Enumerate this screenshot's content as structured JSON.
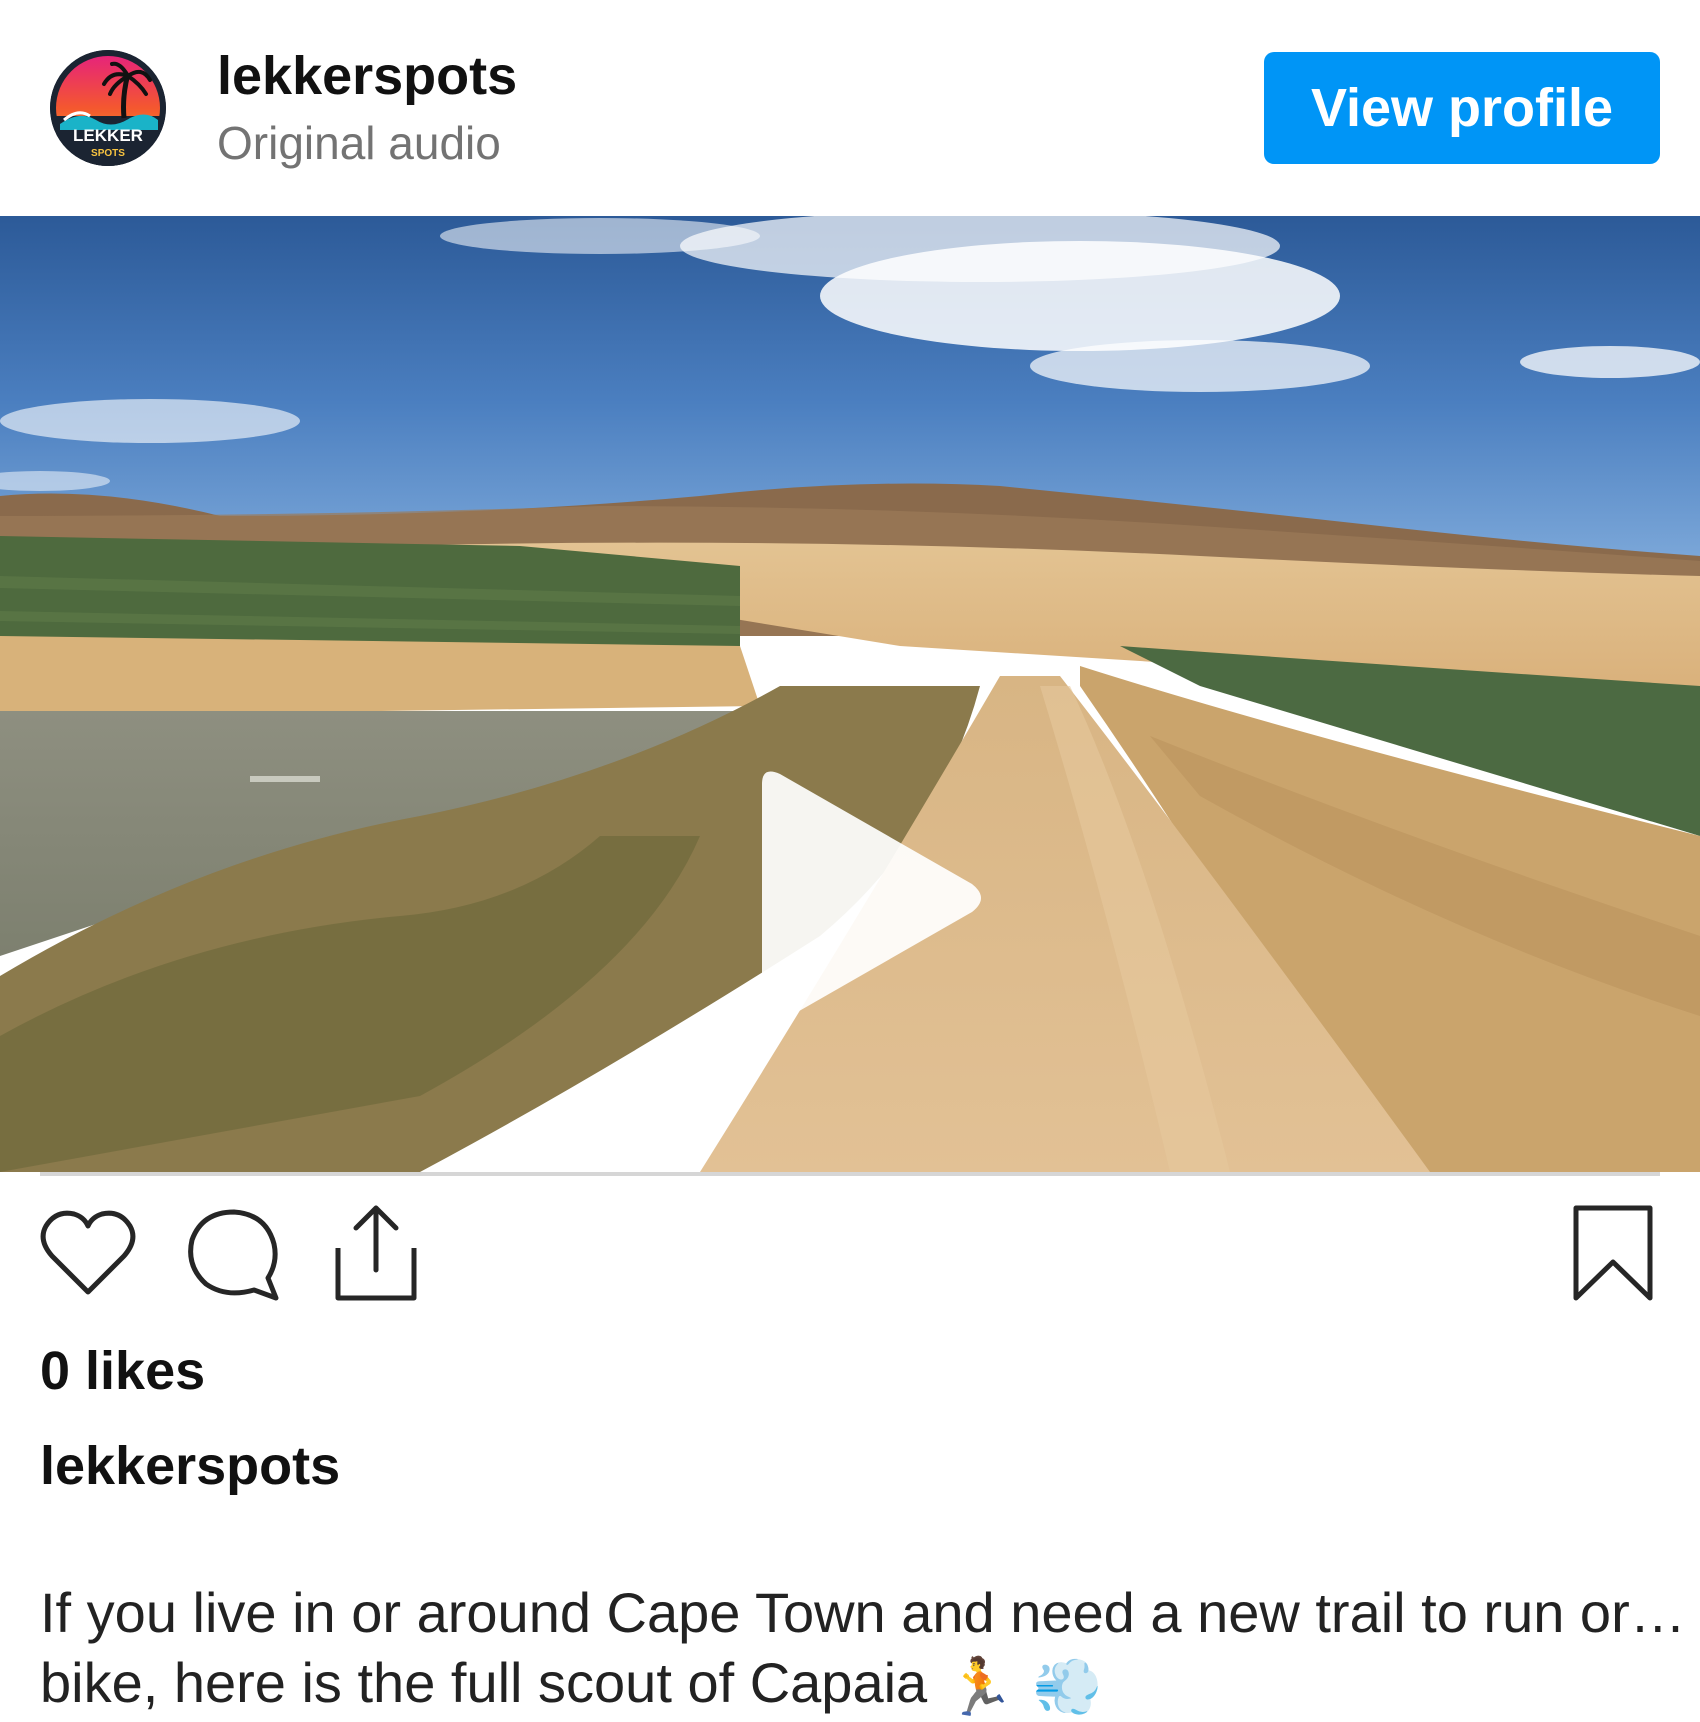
{
  "header": {
    "username": "lekkerspots",
    "audio_label": "Original audio",
    "view_profile_label": "View profile",
    "avatar": {
      "logo_text_main": "LEKKER",
      "logo_text_sub": "SPOTS"
    }
  },
  "media": {
    "type": "video",
    "state": "paused",
    "play_icon": "play-icon",
    "progress": 0
  },
  "actions": {
    "like_icon": "heart-outline-icon",
    "comment_icon": "comment-outline-icon",
    "share_icon": "share-upload-icon",
    "save_icon": "bookmark-outline-icon"
  },
  "likes_text": "0 likes",
  "caption": {
    "username": "lekkerspots",
    "line1": "If you live in or around Cape Town and need a new trail to run or…",
    "line2": "bike, here is the full scout of Capaia",
    "emoji1": "🏃",
    "emoji2": "💨"
  },
  "colors": {
    "accent": "#0095f6",
    "text_primary": "#111111",
    "text_secondary": "#737373"
  }
}
